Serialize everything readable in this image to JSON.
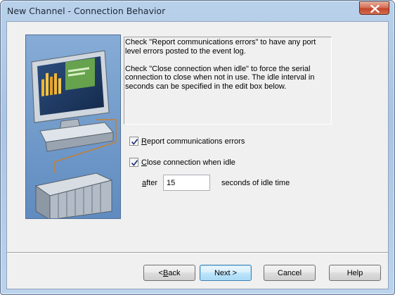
{
  "window": {
    "title": "New Channel - Connection Behavior"
  },
  "description": {
    "paragraph1": "Check \"Report communications errors\" to have any port level errors posted to the event log.",
    "paragraph2": "Check \"Close connection when idle\" to force the serial connection to close when not in use. The idle interval in seconds can be specified in the edit box below."
  },
  "options": {
    "report_errors": {
      "label_prefix": "",
      "label_mnemonic": "R",
      "label_rest": "eport communications errors",
      "checked": true
    },
    "close_idle": {
      "label_prefix": "",
      "label_mnemonic": "C",
      "label_rest": "lose connection when idle",
      "checked": true
    },
    "after_mnemonic": "a",
    "after_rest": "fter",
    "idle_seconds": "15",
    "seconds_label": "seconds of idle time"
  },
  "buttons": {
    "back_prefix": "< ",
    "back_mnemonic": "B",
    "back_rest": "ack",
    "next": "Next >",
    "cancel": "Cancel",
    "help": "Help"
  },
  "icons": {
    "close": "close-icon",
    "check": "checkmark-icon"
  }
}
